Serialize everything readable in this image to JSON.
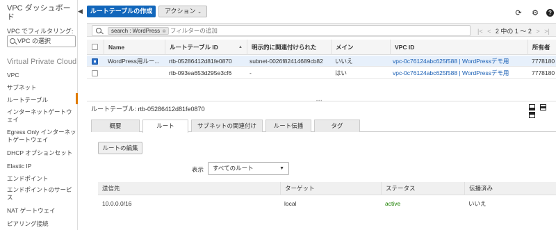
{
  "sidebar": {
    "title": "VPC ダッシュボード",
    "filter_label": "VPC でフィルタリング:",
    "vpc_select_placeholder": "VPC の選択",
    "heading": "Virtual Private Cloud",
    "items": [
      {
        "label": "VPC"
      },
      {
        "label": "サブネット"
      },
      {
        "label": "ルートテーブル"
      },
      {
        "label": "インターネットゲートウェイ"
      },
      {
        "label": "Egress Only インターネットゲートウェイ"
      },
      {
        "label": "DHCP オプションセット"
      },
      {
        "label": "Elastic IP"
      },
      {
        "label": "エンドポイント"
      },
      {
        "label": "エンドポイントのサービス"
      },
      {
        "label": "NAT ゲートウェイ"
      },
      {
        "label": "ピアリング接続"
      }
    ],
    "collapse_glyph": "◀",
    "active_accent": "#e07b00"
  },
  "toolbar": {
    "create_label": "ルートテーブルの作成",
    "action_label": "アクション",
    "caret": "⌄",
    "refresh_glyph": "⟳",
    "settings_glyph": "⚙",
    "help_glyph": "?"
  },
  "filter": {
    "token_label": "search : WordPress",
    "token_close": "⊗",
    "placeholder": "フィルターの追加",
    "pager_first": "|<",
    "pager_prev": "<",
    "pager_text": "2 中の 1 ～ 2",
    "pager_next": ">",
    "pager_last": ">|"
  },
  "table": {
    "columns": [
      "Name",
      "ルートテーブル ID",
      "明示的に関連付けられた",
      "メイン",
      "VPC ID",
      "所有者"
    ],
    "sort_glyph": "▲",
    "rows": [
      {
        "selected": true,
        "name": "WordPress用ルー...",
        "id": "rtb-05286412d81fe0870",
        "assoc": "subnet-0026f82414689cb82",
        "main": "いいえ",
        "vpc": "vpc-0c76124abc625f588 | WordPressデモ用",
        "owner": "7778180"
      },
      {
        "selected": false,
        "name": "",
        "id": "rtb-093ea653d295e3cf6",
        "assoc": "-",
        "main": "はい",
        "vpc": "vpc-0c76124abc625f588 | WordPressデモ用",
        "owner": "7778180"
      }
    ]
  },
  "detail": {
    "title_prefix": "ルートテーブル:",
    "title_id": "rtb-05286412d81fe0870",
    "tabs": [
      "概要",
      "ルート",
      "サブネットの関連付け",
      "ルート伝播",
      "タグ"
    ],
    "active_tab": "ルート",
    "edit_button": "ルートの編集",
    "show_label": "表示",
    "show_value": "すべてのルート",
    "show_caret": "▼",
    "routes": {
      "columns": [
        "送信先",
        "ターゲット",
        "ステータス",
        "伝播済み"
      ],
      "rows": [
        {
          "dest": "10.0.0.0/16",
          "target": "local",
          "status": "active",
          "propagated": "いいえ"
        }
      ],
      "status_color": "#1d8102"
    }
  },
  "colors": {
    "primary": "#1166bb",
    "link": "#1a5fb4",
    "selected_row": "#e7f0fb"
  }
}
